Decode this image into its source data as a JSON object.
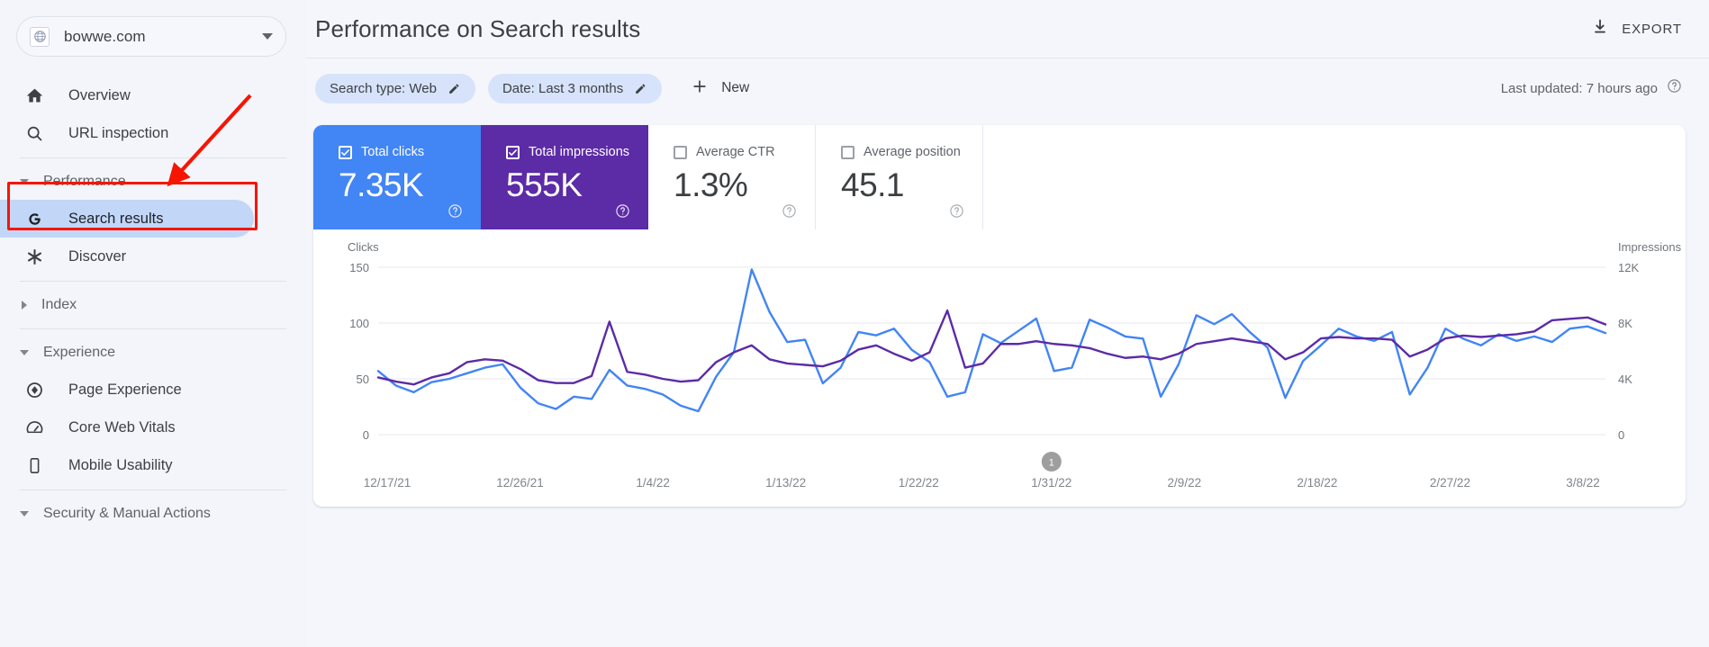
{
  "sidebar": {
    "property": {
      "name": "bowwe.com",
      "favicon_icon": "globe-icon",
      "dropdown_icon": "chevron-down-icon"
    },
    "items": [
      {
        "label": "Overview",
        "icon": "home-icon"
      },
      {
        "label": "URL inspection",
        "icon": "search-icon"
      }
    ],
    "sections": [
      {
        "label": "Performance",
        "expanded": true,
        "icon": "chevron-down-icon"
      },
      {
        "label": "Index",
        "expanded": false,
        "icon": "chevron-right-icon"
      },
      {
        "label": "Experience",
        "expanded": true,
        "icon": "chevron-down-icon"
      },
      {
        "label": "Security & Manual Actions",
        "expanded": true,
        "icon": "chevron-down-icon"
      }
    ],
    "performance_items": [
      {
        "label": "Search results",
        "icon": "google-g-icon",
        "selected": true
      },
      {
        "label": "Discover",
        "icon": "asterisk-icon",
        "selected": false
      }
    ],
    "experience_items": [
      {
        "label": "Page Experience",
        "icon": "page-experience-icon"
      },
      {
        "label": "Core Web Vitals",
        "icon": "speedometer-icon"
      },
      {
        "label": "Mobile Usability",
        "icon": "mobile-phone-icon"
      }
    ],
    "highlight_color": "#f61500",
    "selected_bg": "#c2d7f7"
  },
  "header": {
    "title": "Performance on Search results",
    "export_label": "EXPORT",
    "export_icon": "download-icon"
  },
  "filters": {
    "chips": [
      {
        "label": "Search type: Web",
        "edit_icon": "pencil-icon"
      },
      {
        "label": "Date: Last 3 months",
        "edit_icon": "pencil-icon"
      }
    ],
    "new_label": "New",
    "new_icon": "plus-icon",
    "last_updated": "Last updated: 7 hours ago",
    "help_icon": "help-circle-icon"
  },
  "metrics": [
    {
      "label": "Total clicks",
      "value": "7.35K",
      "checked": true,
      "color": "#4285f4",
      "help_icon": "help-circle-icon"
    },
    {
      "label": "Total impressions",
      "value": "555K",
      "checked": true,
      "color": "#5c2ba6",
      "help_icon": "help-circle-icon"
    },
    {
      "label": "Average CTR",
      "value": "1.3%",
      "checked": false,
      "color": "#ffffff",
      "help_icon": "help-circle-icon"
    },
    {
      "label": "Average position",
      "value": "45.1",
      "checked": false,
      "color": "#ffffff",
      "help_icon": "help-circle-icon"
    }
  ],
  "chart_data": {
    "type": "line",
    "title": "",
    "xlabel": "",
    "ylabel": "Clicks",
    "y2label": "Impressions",
    "grid": true,
    "legend": "none",
    "annotation": {
      "label": "1",
      "x_position": "1/31/22"
    },
    "left_axis": {
      "label": "Clicks",
      "ticks": [
        0,
        50,
        100,
        150
      ],
      "ylim": [
        0,
        150
      ],
      "tick_labels": [
        "0",
        "50",
        "100",
        "150"
      ]
    },
    "right_axis": {
      "label": "Impressions",
      "ticks": [
        0,
        4000,
        8000,
        12000
      ],
      "ylim": [
        0,
        12000
      ],
      "tick_labels": [
        "0",
        "4K",
        "8K",
        "12K"
      ]
    },
    "x_tick_labels": [
      "12/17/21",
      "12/26/21",
      "1/4/22",
      "1/13/22",
      "1/22/22",
      "1/31/22",
      "2/9/22",
      "2/18/22",
      "2/27/22",
      "3/8/22"
    ],
    "series": [
      {
        "name": "Clicks",
        "color": "#4285f4",
        "axis": "left",
        "values": [
          57,
          44,
          38,
          47,
          50,
          55,
          60,
          63,
          42,
          28,
          23,
          34,
          32,
          58,
          44,
          41,
          36,
          26,
          21,
          52,
          74,
          148,
          110,
          83,
          85,
          46,
          60,
          92,
          89,
          95,
          76,
          65,
          34,
          38,
          90,
          82,
          93,
          104,
          57,
          60,
          103,
          96,
          88,
          86,
          34,
          63,
          107,
          99,
          108,
          92,
          78,
          33,
          66,
          80,
          95,
          88,
          84,
          92,
          36,
          60,
          95,
          86,
          80,
          90,
          84,
          88,
          83,
          95,
          97,
          91
        ]
      },
      {
        "name": "Impressions",
        "color": "#5c2ba6",
        "axis": "right",
        "values": [
          4100,
          3800,
          3600,
          4100,
          4400,
          5200,
          5400,
          5300,
          4700,
          3900,
          3700,
          3700,
          4200,
          8100,
          4500,
          4300,
          4000,
          3800,
          3900,
          5200,
          5900,
          6400,
          5400,
          5100,
          5000,
          4900,
          5300,
          6100,
          6400,
          5800,
          5300,
          5900,
          8900,
          4800,
          5100,
          6500,
          6500,
          6700,
          6500,
          6400,
          6200,
          5800,
          5500,
          5600,
          5400,
          5800,
          6500,
          6700,
          6900,
          6700,
          6500,
          5400,
          5900,
          6900,
          7000,
          6900,
          6900,
          6800,
          5600,
          6100,
          6900,
          7100,
          7000,
          7100,
          7200,
          7400,
          8200,
          8300,
          8400,
          7900
        ]
      }
    ]
  }
}
